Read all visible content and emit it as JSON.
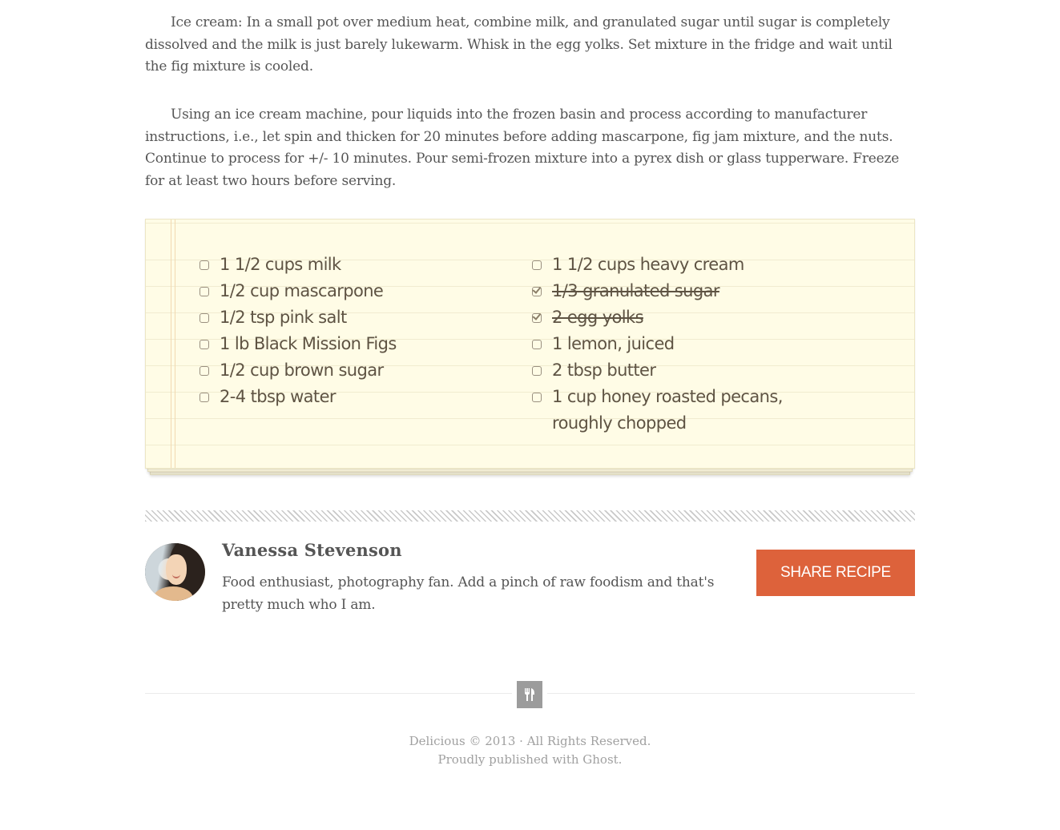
{
  "article": {
    "paragraph_ice_cream": "Ice cream: In a small pot over medium heat, combine milk, and granulated sugar until sugar is completely dissolved and the milk is just barely lukewarm. Whisk in the egg yolks. Set mixture in the fridge and wait until the fig mixture is cooled.",
    "paragraph_machine": "Using an ice cream machine, pour liquids into the frozen basin and process according to manufacturer instructions, i.e., let spin and thicken for 20 minutes before adding mascarpone, fig jam mixture, and the nuts. Continue to process for +/- 10 minutes. Pour semi-frozen mixture into a pyrex dish or glass tupperware. Freeze for at least two hours before serving."
  },
  "ingredients": {
    "left": [
      {
        "label": "1 1/2 cups milk",
        "checked": false
      },
      {
        "label": "1/2 cup mascarpone",
        "checked": false
      },
      {
        "label": "1/2 tsp pink salt",
        "checked": false
      },
      {
        "label": "1 lb Black Mission Figs",
        "checked": false
      },
      {
        "label": "1/2 cup brown sugar",
        "checked": false
      },
      {
        "label": "2-4 tbsp water",
        "checked": false
      }
    ],
    "right": [
      {
        "label": "1 1/2 cups heavy cream",
        "checked": false
      },
      {
        "label": "1/3 granulated sugar",
        "checked": true
      },
      {
        "label": "2 egg yolks",
        "checked": true
      },
      {
        "label": "1 lemon, juiced",
        "checked": false
      },
      {
        "label": "2 tbsp butter",
        "checked": false
      },
      {
        "label": "1 cup honey roasted pecans, roughly chopped",
        "checked": false
      }
    ]
  },
  "author": {
    "name": "Vanessa Stevenson",
    "bio": "Food enthusiast, photography fan. Add a pinch of raw foodism and that's pretty much who I am."
  },
  "share_button": {
    "label": "SHARE RECIPE",
    "color": "#dd623b"
  },
  "footer": {
    "icon": "fork-knife-icon",
    "copyright": "Delicious © 2013 · All Rights Reserved.",
    "published": "Proudly published with Ghost."
  },
  "colors": {
    "notepad_bg": "#fffce6",
    "text": "#555555"
  }
}
